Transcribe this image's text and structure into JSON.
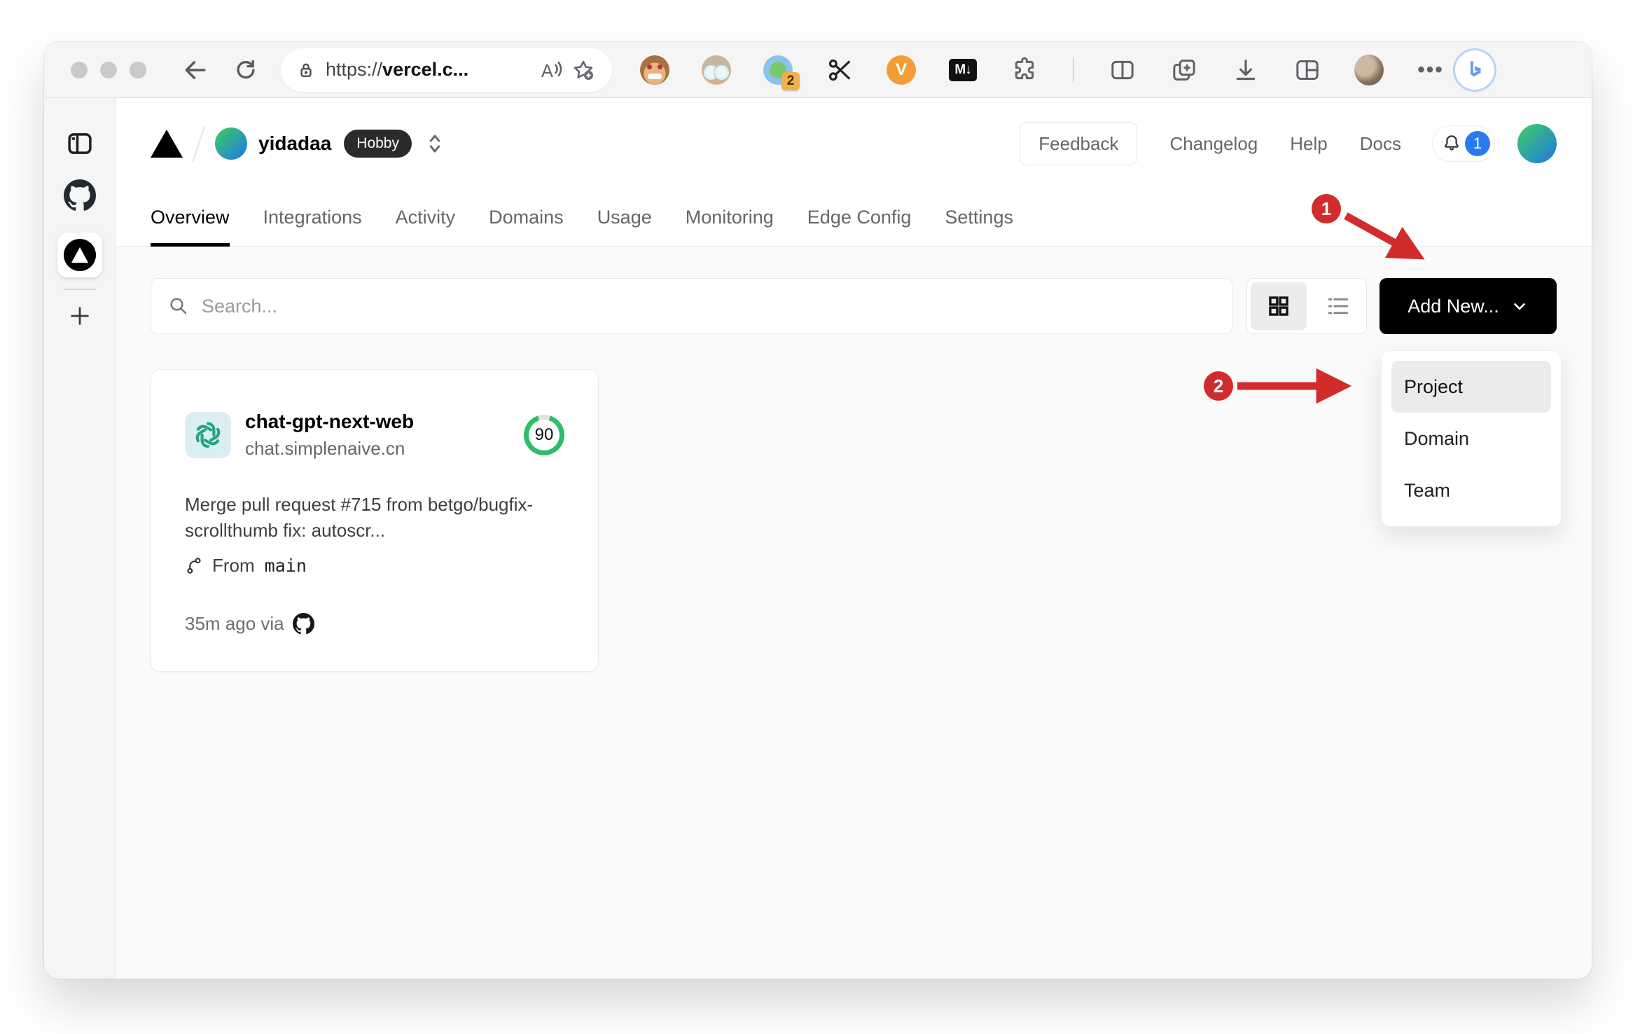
{
  "browser": {
    "url_prefix": "https://",
    "url_host": "vercel.c...",
    "read_aloud_label": "A",
    "extensions": {
      "translator_badge": "2",
      "video_label": "V",
      "markdown_label": "M↓",
      "more_label": "•••"
    }
  },
  "header": {
    "account_name": "yidadaa",
    "plan_badge": "Hobby",
    "feedback_label": "Feedback",
    "links": [
      "Changelog",
      "Help",
      "Docs"
    ],
    "notification_count": "1"
  },
  "tabs": {
    "items": [
      {
        "label": "Overview"
      },
      {
        "label": "Integrations"
      },
      {
        "label": "Activity"
      },
      {
        "label": "Domains"
      },
      {
        "label": "Usage"
      },
      {
        "label": "Monitoring"
      },
      {
        "label": "Edge Config"
      },
      {
        "label": "Settings"
      }
    ]
  },
  "controls": {
    "search_placeholder": "Search...",
    "add_new_label": "Add New..."
  },
  "dropdown": {
    "items": [
      "Project",
      "Domain",
      "Team"
    ]
  },
  "card": {
    "name": "chat-gpt-next-web",
    "domain": "chat.simplenaive.cn",
    "score": "90",
    "commit_message": "Merge pull request #715 from betgo/bugfix-scrollthumb fix: autoscr...",
    "from_label": "From",
    "branch": "main",
    "deployed_meta": "35m ago via"
  },
  "annotations": {
    "step1": "1",
    "step2": "2"
  },
  "colors": {
    "annotation_red": "#d22b2b",
    "notification_blue": "#2979f0",
    "score_green": "#2cbe6a",
    "add_button_bg": "#000000",
    "extension_badge_orange": "#f0b04c"
  }
}
